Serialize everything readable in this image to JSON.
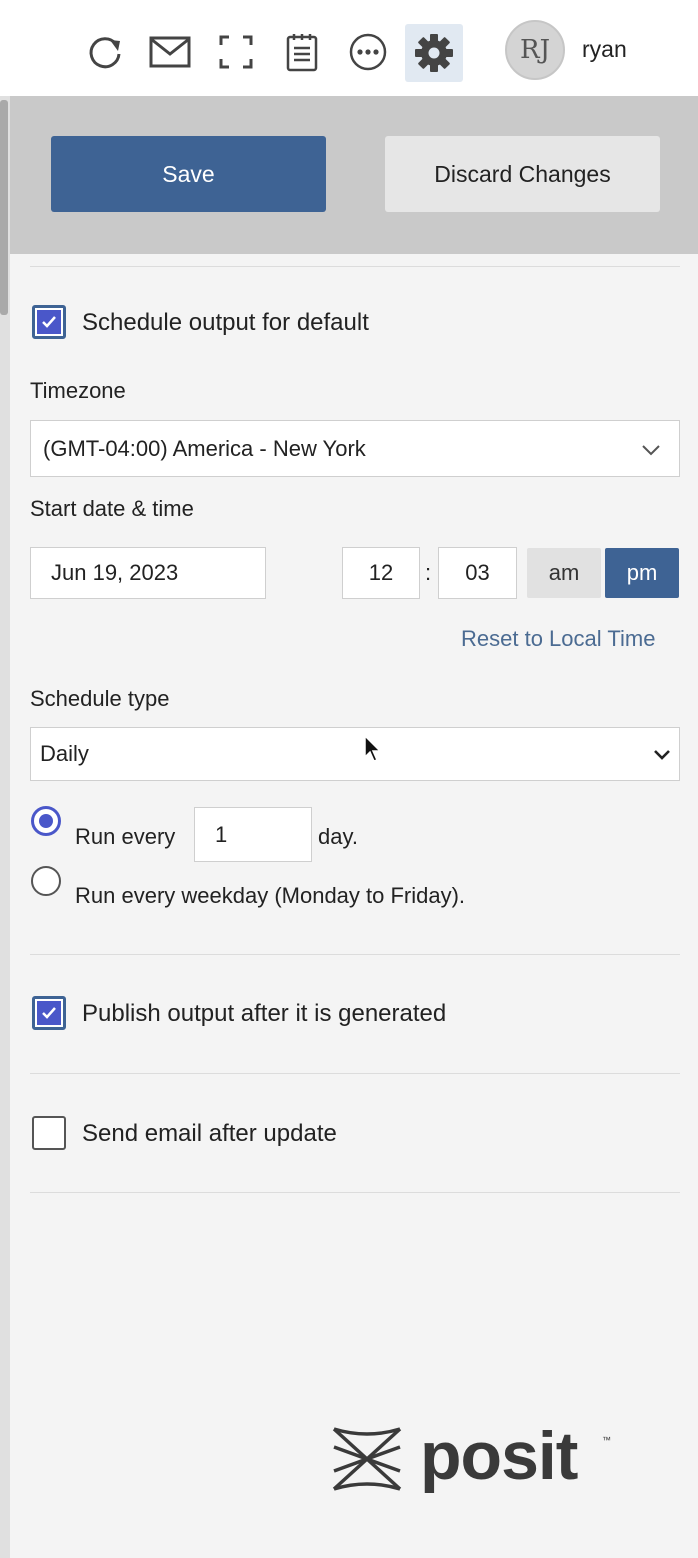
{
  "toolbar": {
    "icons": [
      "refresh-icon",
      "mail-icon",
      "fullscreen-icon",
      "notepad-icon",
      "more-icon",
      "gear-icon"
    ],
    "user_initials": "RJ",
    "username": "ryan"
  },
  "actions": {
    "save_label": "Save",
    "discard_label": "Discard Changes"
  },
  "schedule": {
    "enabled_label": "Schedule output for default",
    "enabled": true,
    "timezone_label": "Timezone",
    "timezone_value": "(GMT-04:00) America - New York",
    "start_label": "Start date & time",
    "start_date": "Jun 19, 2023",
    "hour": "12",
    "time_sep": ":",
    "minute": "03",
    "am_label": "am",
    "pm_label": "pm",
    "selected_period": "pm",
    "reset_link": "Reset to Local Time",
    "type_label": "Schedule type",
    "type_value": "Daily",
    "run_every_prefix": "Run every",
    "run_every_value": "1",
    "run_every_suffix": "day.",
    "weekday_label": "Run every weekday (Monday to Friday).",
    "selected_option": "run-every"
  },
  "publish": {
    "label": "Publish output after it is generated",
    "checked": true
  },
  "email": {
    "label": "Send email after update",
    "checked": false
  },
  "brand": {
    "logo_text": "posit",
    "trademark": "™"
  },
  "colors": {
    "primary": "#3e6394",
    "accent": "#4a57c9",
    "link": "#4b6b92"
  }
}
